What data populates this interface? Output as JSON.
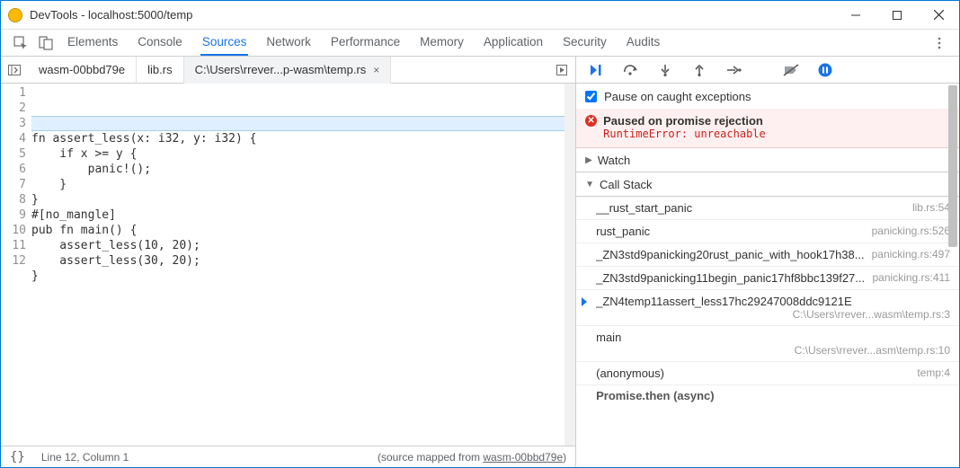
{
  "window": {
    "title": "DevTools - localhost:5000/temp"
  },
  "panels": [
    "Elements",
    "Console",
    "Sources",
    "Network",
    "Performance",
    "Memory",
    "Application",
    "Security",
    "Audits"
  ],
  "active_panel": "Sources",
  "file_tabs": {
    "items": [
      "wasm-00bbd79e",
      "lib.rs",
      "C:\\Users\\rrever...p-wasm\\temp.rs"
    ],
    "active_index": 2
  },
  "source": {
    "lines": [
      "fn assert_less(x: i32, y: i32) {",
      "    if x >= y {",
      "        panic!();",
      "    }",
      "}",
      "",
      "#[no_mangle]",
      "pub fn main() {",
      "    assert_less(10, 20);",
      "    assert_less(30, 20);",
      "}",
      ""
    ],
    "highlighted_line": 3
  },
  "status": {
    "position": "Line 12, Column 1",
    "mapped_prefix": "(source mapped from ",
    "mapped_link": "wasm-00bbd79e",
    "mapped_suffix": ")"
  },
  "debugger": {
    "pause_on_caught": "Pause on caught exceptions",
    "paused_title": "Paused on promise rejection",
    "paused_msg": "RuntimeError: unreachable",
    "watch_label": "Watch",
    "callstack_label": "Call Stack",
    "async_label": "Promise.then (async)",
    "frames": [
      {
        "fn": "__rust_start_panic",
        "loc": "lib.rs:54",
        "current": false
      },
      {
        "fn": "rust_panic",
        "loc": "panicking.rs:526",
        "current": false
      },
      {
        "fn": "_ZN3std9panicking20rust_panic_with_hook17h38...",
        "loc": "panicking.rs:497",
        "current": false
      },
      {
        "fn": "_ZN3std9panicking11begin_panic17hf8bbc139f27...",
        "loc": "panicking.rs:411",
        "current": false
      },
      {
        "fn": "_ZN4temp11assert_less17hc29247008ddc9121E",
        "loc": "C:\\Users\\rrever...wasm\\temp.rs:3",
        "current": true
      },
      {
        "fn": "main",
        "loc": "C:\\Users\\rrever...asm\\temp.rs:10",
        "current": false
      },
      {
        "fn": "(anonymous)",
        "loc": "temp:4",
        "current": false
      }
    ]
  }
}
